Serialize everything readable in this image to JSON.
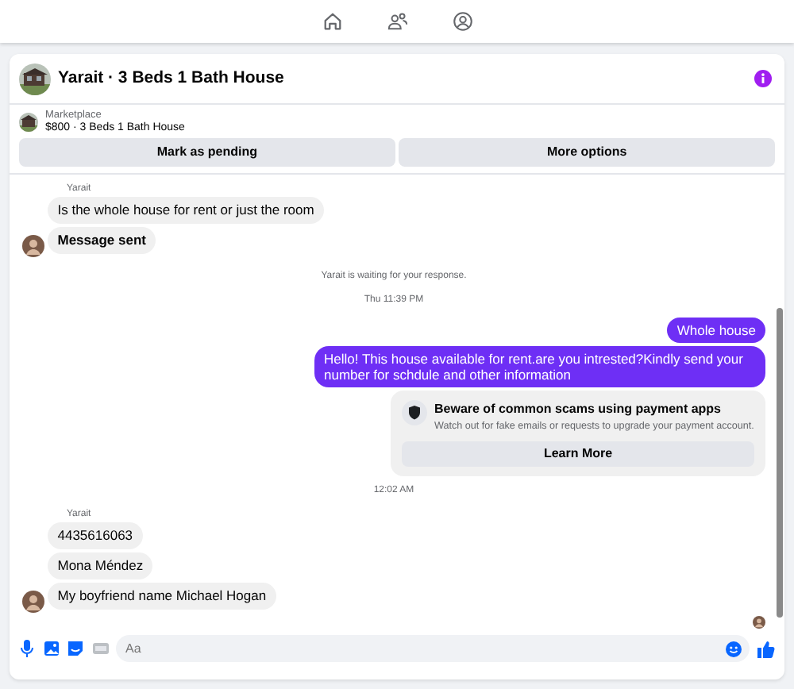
{
  "conversation": {
    "title": "Yarait · 3 Beds 1 Bath House"
  },
  "listing": {
    "source": "Marketplace",
    "summary": "$800 · 3 Beds 1 Bath House"
  },
  "actions": [
    "Mark as pending",
    "More options"
  ],
  "messages": [
    {
      "kind": "incoming",
      "sender": "Yarait",
      "bubbles": [
        {
          "text": "Is the whole house for rent or just the room",
          "bold": false
        },
        {
          "text": "Message sent",
          "bold": true
        }
      ]
    },
    {
      "kind": "notice",
      "text": "Yarait is waiting for your response."
    },
    {
      "kind": "timestamp",
      "text": "Thu 11:39 PM"
    },
    {
      "kind": "outgoing",
      "bubbles": [
        {
          "text": "Whole house"
        },
        {
          "text": "Hello! This house available for rent.are you intrested?Kindly send your number for schdule and other information"
        }
      ]
    },
    {
      "kind": "alert",
      "title": "Beware of common scams using payment apps",
      "body": "Watch out for fake emails or requests to upgrade your payment account.",
      "button": "Learn More"
    },
    {
      "kind": "timestamp",
      "text": "12:02 AM"
    },
    {
      "kind": "incoming",
      "sender": "Yarait",
      "bubbles": [
        {
          "text": "4435616063",
          "bold": false
        },
        {
          "text": "Mona Méndez",
          "bold": false
        },
        {
          "text": "My boyfriend name Michael Hogan",
          "bold": false
        }
      ]
    },
    {
      "kind": "seen"
    }
  ],
  "composer": {
    "placeholder": "Aa"
  }
}
